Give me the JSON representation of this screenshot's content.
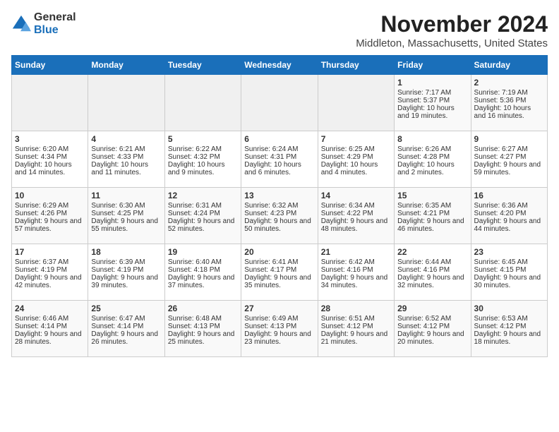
{
  "logo": {
    "general": "General",
    "blue": "Blue"
  },
  "title": "November 2024",
  "subtitle": "Middleton, Massachusetts, United States",
  "headers": [
    "Sunday",
    "Monday",
    "Tuesday",
    "Wednesday",
    "Thursday",
    "Friday",
    "Saturday"
  ],
  "weeks": [
    [
      {
        "day": "",
        "empty": true
      },
      {
        "day": "",
        "empty": true
      },
      {
        "day": "",
        "empty": true
      },
      {
        "day": "",
        "empty": true
      },
      {
        "day": "",
        "empty": true
      },
      {
        "day": "1",
        "sunrise": "Sunrise: 7:17 AM",
        "sunset": "Sunset: 5:37 PM",
        "daylight": "Daylight: 10 hours and 19 minutes."
      },
      {
        "day": "2",
        "sunrise": "Sunrise: 7:19 AM",
        "sunset": "Sunset: 5:36 PM",
        "daylight": "Daylight: 10 hours and 16 minutes."
      }
    ],
    [
      {
        "day": "3",
        "sunrise": "Sunrise: 6:20 AM",
        "sunset": "Sunset: 4:34 PM",
        "daylight": "Daylight: 10 hours and 14 minutes."
      },
      {
        "day": "4",
        "sunrise": "Sunrise: 6:21 AM",
        "sunset": "Sunset: 4:33 PM",
        "daylight": "Daylight: 10 hours and 11 minutes."
      },
      {
        "day": "5",
        "sunrise": "Sunrise: 6:22 AM",
        "sunset": "Sunset: 4:32 PM",
        "daylight": "Daylight: 10 hours and 9 minutes."
      },
      {
        "day": "6",
        "sunrise": "Sunrise: 6:24 AM",
        "sunset": "Sunset: 4:31 PM",
        "daylight": "Daylight: 10 hours and 6 minutes."
      },
      {
        "day": "7",
        "sunrise": "Sunrise: 6:25 AM",
        "sunset": "Sunset: 4:29 PM",
        "daylight": "Daylight: 10 hours and 4 minutes."
      },
      {
        "day": "8",
        "sunrise": "Sunrise: 6:26 AM",
        "sunset": "Sunset: 4:28 PM",
        "daylight": "Daylight: 10 hours and 2 minutes."
      },
      {
        "day": "9",
        "sunrise": "Sunrise: 6:27 AM",
        "sunset": "Sunset: 4:27 PM",
        "daylight": "Daylight: 9 hours and 59 minutes."
      }
    ],
    [
      {
        "day": "10",
        "sunrise": "Sunrise: 6:29 AM",
        "sunset": "Sunset: 4:26 PM",
        "daylight": "Daylight: 9 hours and 57 minutes."
      },
      {
        "day": "11",
        "sunrise": "Sunrise: 6:30 AM",
        "sunset": "Sunset: 4:25 PM",
        "daylight": "Daylight: 9 hours and 55 minutes."
      },
      {
        "day": "12",
        "sunrise": "Sunrise: 6:31 AM",
        "sunset": "Sunset: 4:24 PM",
        "daylight": "Daylight: 9 hours and 52 minutes."
      },
      {
        "day": "13",
        "sunrise": "Sunrise: 6:32 AM",
        "sunset": "Sunset: 4:23 PM",
        "daylight": "Daylight: 9 hours and 50 minutes."
      },
      {
        "day": "14",
        "sunrise": "Sunrise: 6:34 AM",
        "sunset": "Sunset: 4:22 PM",
        "daylight": "Daylight: 9 hours and 48 minutes."
      },
      {
        "day": "15",
        "sunrise": "Sunrise: 6:35 AM",
        "sunset": "Sunset: 4:21 PM",
        "daylight": "Daylight: 9 hours and 46 minutes."
      },
      {
        "day": "16",
        "sunrise": "Sunrise: 6:36 AM",
        "sunset": "Sunset: 4:20 PM",
        "daylight": "Daylight: 9 hours and 44 minutes."
      }
    ],
    [
      {
        "day": "17",
        "sunrise": "Sunrise: 6:37 AM",
        "sunset": "Sunset: 4:19 PM",
        "daylight": "Daylight: 9 hours and 42 minutes."
      },
      {
        "day": "18",
        "sunrise": "Sunrise: 6:39 AM",
        "sunset": "Sunset: 4:19 PM",
        "daylight": "Daylight: 9 hours and 39 minutes."
      },
      {
        "day": "19",
        "sunrise": "Sunrise: 6:40 AM",
        "sunset": "Sunset: 4:18 PM",
        "daylight": "Daylight: 9 hours and 37 minutes."
      },
      {
        "day": "20",
        "sunrise": "Sunrise: 6:41 AM",
        "sunset": "Sunset: 4:17 PM",
        "daylight": "Daylight: 9 hours and 35 minutes."
      },
      {
        "day": "21",
        "sunrise": "Sunrise: 6:42 AM",
        "sunset": "Sunset: 4:16 PM",
        "daylight": "Daylight: 9 hours and 34 minutes."
      },
      {
        "day": "22",
        "sunrise": "Sunrise: 6:44 AM",
        "sunset": "Sunset: 4:16 PM",
        "daylight": "Daylight: 9 hours and 32 minutes."
      },
      {
        "day": "23",
        "sunrise": "Sunrise: 6:45 AM",
        "sunset": "Sunset: 4:15 PM",
        "daylight": "Daylight: 9 hours and 30 minutes."
      }
    ],
    [
      {
        "day": "24",
        "sunrise": "Sunrise: 6:46 AM",
        "sunset": "Sunset: 4:14 PM",
        "daylight": "Daylight: 9 hours and 28 minutes."
      },
      {
        "day": "25",
        "sunrise": "Sunrise: 6:47 AM",
        "sunset": "Sunset: 4:14 PM",
        "daylight": "Daylight: 9 hours and 26 minutes."
      },
      {
        "day": "26",
        "sunrise": "Sunrise: 6:48 AM",
        "sunset": "Sunset: 4:13 PM",
        "daylight": "Daylight: 9 hours and 25 minutes."
      },
      {
        "day": "27",
        "sunrise": "Sunrise: 6:49 AM",
        "sunset": "Sunset: 4:13 PM",
        "daylight": "Daylight: 9 hours and 23 minutes."
      },
      {
        "day": "28",
        "sunrise": "Sunrise: 6:51 AM",
        "sunset": "Sunset: 4:12 PM",
        "daylight": "Daylight: 9 hours and 21 minutes."
      },
      {
        "day": "29",
        "sunrise": "Sunrise: 6:52 AM",
        "sunset": "Sunset: 4:12 PM",
        "daylight": "Daylight: 9 hours and 20 minutes."
      },
      {
        "day": "30",
        "sunrise": "Sunrise: 6:53 AM",
        "sunset": "Sunset: 4:12 PM",
        "daylight": "Daylight: 9 hours and 18 minutes."
      }
    ]
  ]
}
